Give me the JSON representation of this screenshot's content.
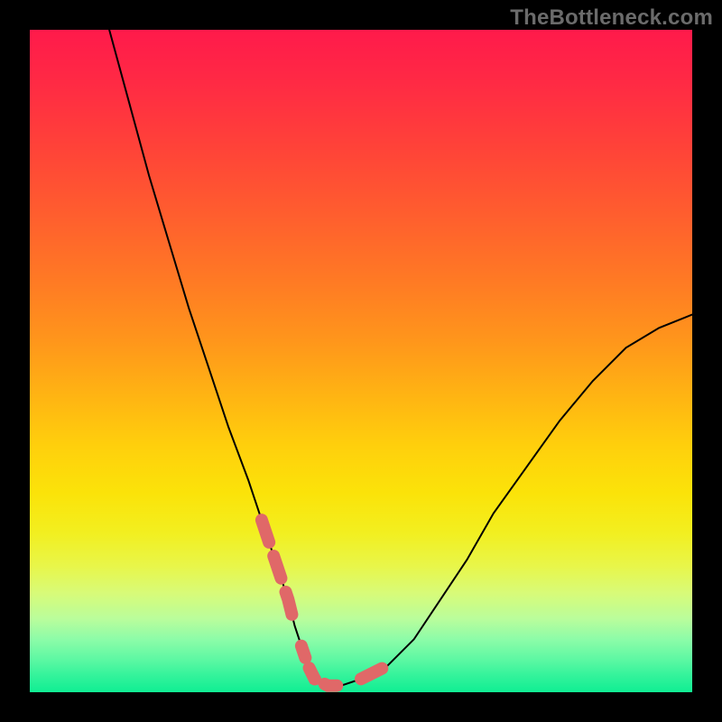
{
  "watermark": "TheBottleneck.com",
  "colors": {
    "background_black": "#000000",
    "gradient_top": "#ff1a4b",
    "gradient_bottom": "#10ee93",
    "curve_color": "#000000",
    "dash_color": "#e06868"
  },
  "chart_data": {
    "type": "line",
    "title": "",
    "xlabel": "",
    "ylabel": "",
    "xlim": [
      0,
      100
    ],
    "ylim": [
      0,
      100
    ],
    "grid": false,
    "layout_note": "Vertical warm-to-green gradient background; black V-shaped curve; salmon dashed highlights on lower arms and trough",
    "series": [
      {
        "name": "bottleneck-curve",
        "color": "#000000",
        "x": [
          12,
          15,
          18,
          21,
          24,
          27,
          30,
          33,
          35,
          37,
          39,
          40,
          41,
          42,
          43,
          45,
          47,
          50,
          54,
          58,
          62,
          66,
          70,
          75,
          80,
          85,
          90,
          95,
          100
        ],
        "values": [
          100,
          89,
          78,
          68,
          58,
          49,
          40,
          32,
          26,
          20,
          14,
          10,
          7,
          4,
          2,
          1,
          1,
          2,
          4,
          8,
          14,
          20,
          27,
          34,
          41,
          47,
          52,
          55,
          57
        ]
      }
    ],
    "highlight": {
      "name": "sweet-spot-dashes",
      "color": "#e06868",
      "segments": [
        {
          "x": [
            35,
            37,
            39,
            40
          ],
          "values": [
            26,
            20,
            14,
            10
          ]
        },
        {
          "x": [
            41,
            42,
            43,
            45,
            47
          ],
          "values": [
            7,
            4,
            2,
            1,
            1
          ]
        },
        {
          "x": [
            50,
            54
          ],
          "values": [
            2,
            4
          ]
        }
      ]
    }
  }
}
